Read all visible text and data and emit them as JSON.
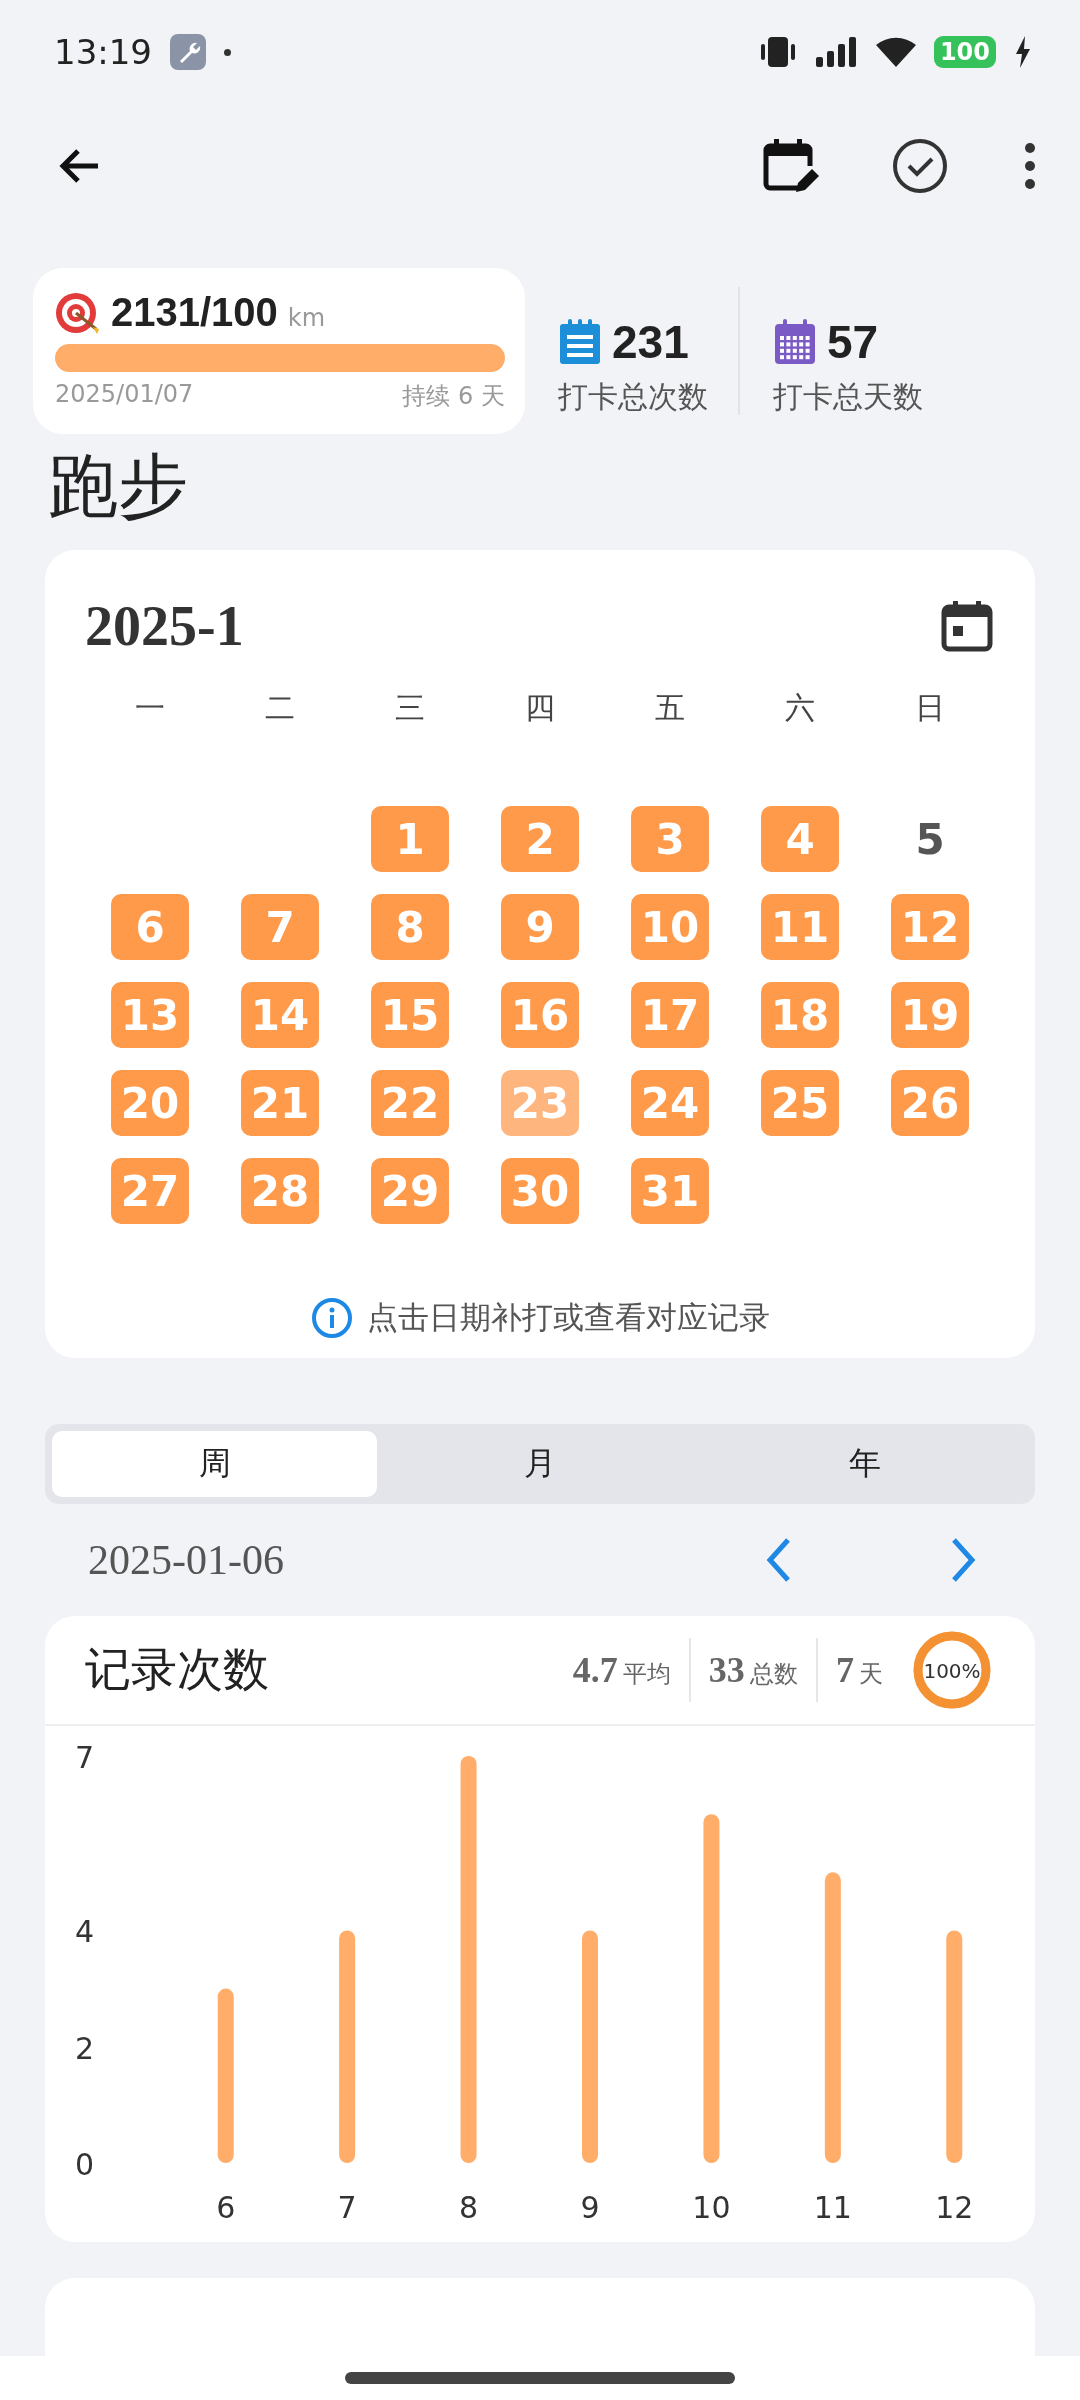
{
  "status_bar": {
    "time": "13:19",
    "battery": "100"
  },
  "goal": {
    "value": "2131/100",
    "unit": "km",
    "level": 1,
    "date": "2025/01/07",
    "streak": "持续 6 天"
  },
  "stats": [
    {
      "kind": "count",
      "value": "231",
      "label": "打卡总次数"
    },
    {
      "kind": "days",
      "value": "57",
      "label": "打卡总天数"
    }
  ],
  "title": "跑步",
  "calendar": {
    "month": "2025-1",
    "weekdays": [
      "一",
      "二",
      "三",
      "四",
      "五",
      "六",
      "日"
    ],
    "days": [
      {
        "label": "1",
        "checked": true,
        "today": false
      },
      {
        "label": "2",
        "checked": true,
        "today": false
      },
      {
        "label": "3",
        "checked": true,
        "today": false
      },
      {
        "label": "4",
        "checked": true,
        "today": false
      },
      {
        "label": "5",
        "checked": false,
        "today": false
      },
      {
        "label": "6",
        "checked": true,
        "today": false
      },
      {
        "label": "7",
        "checked": true,
        "today": false
      },
      {
        "label": "8",
        "checked": true,
        "today": false
      },
      {
        "label": "9",
        "checked": true,
        "today": false
      },
      {
        "label": "10",
        "checked": true,
        "today": false
      },
      {
        "label": "11",
        "checked": true,
        "today": false
      },
      {
        "label": "12",
        "checked": true,
        "today": false
      },
      {
        "label": "13",
        "checked": true,
        "today": false
      },
      {
        "label": "14",
        "checked": true,
        "today": false
      },
      {
        "label": "15",
        "checked": true,
        "today": false
      },
      {
        "label": "16",
        "checked": true,
        "today": false
      },
      {
        "label": "17",
        "checked": true,
        "today": false
      },
      {
        "label": "18",
        "checked": true,
        "today": false
      },
      {
        "label": "19",
        "checked": true,
        "today": false
      },
      {
        "label": "20",
        "checked": true,
        "today": false
      },
      {
        "label": "21",
        "checked": true,
        "today": false
      },
      {
        "label": "22",
        "checked": true,
        "today": false
      },
      {
        "label": "23",
        "checked": true,
        "today": true
      },
      {
        "label": "24",
        "checked": true,
        "today": false
      },
      {
        "label": "25",
        "checked": true,
        "today": false
      },
      {
        "label": "26",
        "checked": true,
        "today": false
      },
      {
        "label": "27",
        "checked": true,
        "today": false
      },
      {
        "label": "28",
        "checked": true,
        "today": false
      },
      {
        "label": "29",
        "checked": true,
        "today": false
      },
      {
        "label": "30",
        "checked": true,
        "today": false
      },
      {
        "label": "31",
        "checked": true,
        "today": false
      }
    ],
    "hint": "点击日期补打或查看对应记录"
  },
  "period_tabs": [
    {
      "label": "周",
      "selected": true
    },
    {
      "label": "月",
      "selected": false
    },
    {
      "label": "年",
      "selected": false
    }
  ],
  "period_start": "2025-01-06",
  "record_card": {
    "title": "记录次数",
    "summary": [
      {
        "amount": "4.7",
        "unit": "平均"
      },
      {
        "amount": "33",
        "unit": "总数"
      },
      {
        "amount": "7",
        "unit": "天"
      }
    ],
    "completion": {
      "label": "100%",
      "level": 1
    },
    "chart_data": {
      "type": "bar",
      "categories": [
        "6",
        "7",
        "8",
        "9",
        "10",
        "11",
        "12"
      ],
      "series": [
        {
          "color": "#ffad69",
          "values": [
            3,
            4,
            7,
            4,
            6,
            5,
            4
          ]
        }
      ],
      "ylim": [
        0,
        7
      ],
      "yticks": [
        0,
        2,
        4,
        7
      ]
    }
  }
}
